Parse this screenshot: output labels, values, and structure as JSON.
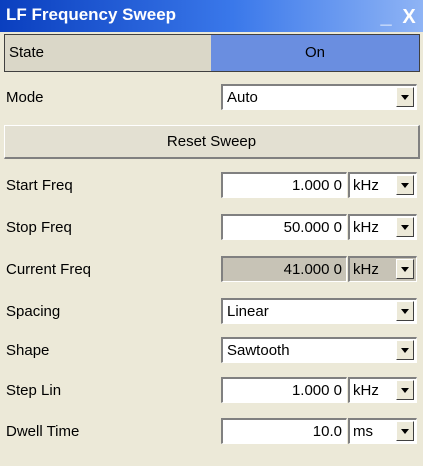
{
  "window": {
    "title": "LF Frequency Sweep",
    "minimize_glyph": "_",
    "close_glyph": "X"
  },
  "state": {
    "label": "State",
    "value": "On"
  },
  "mode": {
    "label": "Mode",
    "value": "Auto"
  },
  "reset": {
    "label": "Reset Sweep"
  },
  "start_freq": {
    "label": "Start Freq",
    "value": "1.000 0",
    "unit": "kHz"
  },
  "stop_freq": {
    "label": "Stop Freq",
    "value": "50.000 0",
    "unit": "kHz"
  },
  "current_freq": {
    "label": "Current Freq",
    "value": "41.000 0",
    "unit": "kHz"
  },
  "spacing": {
    "label": "Spacing",
    "value": "Linear"
  },
  "shape": {
    "label": "Shape",
    "value": "Sawtooth"
  },
  "step_lin": {
    "label": "Step Lin",
    "value": "1.000 0",
    "unit": "kHz"
  },
  "dwell_time": {
    "label": "Dwell Time",
    "value": "10.0",
    "unit": "ms"
  },
  "colors": {
    "title_start": "#0a3fbf",
    "toggle_on": "#6a8ee0",
    "panel": "#ece9d8",
    "readonly_field": "#c7c3b6"
  }
}
